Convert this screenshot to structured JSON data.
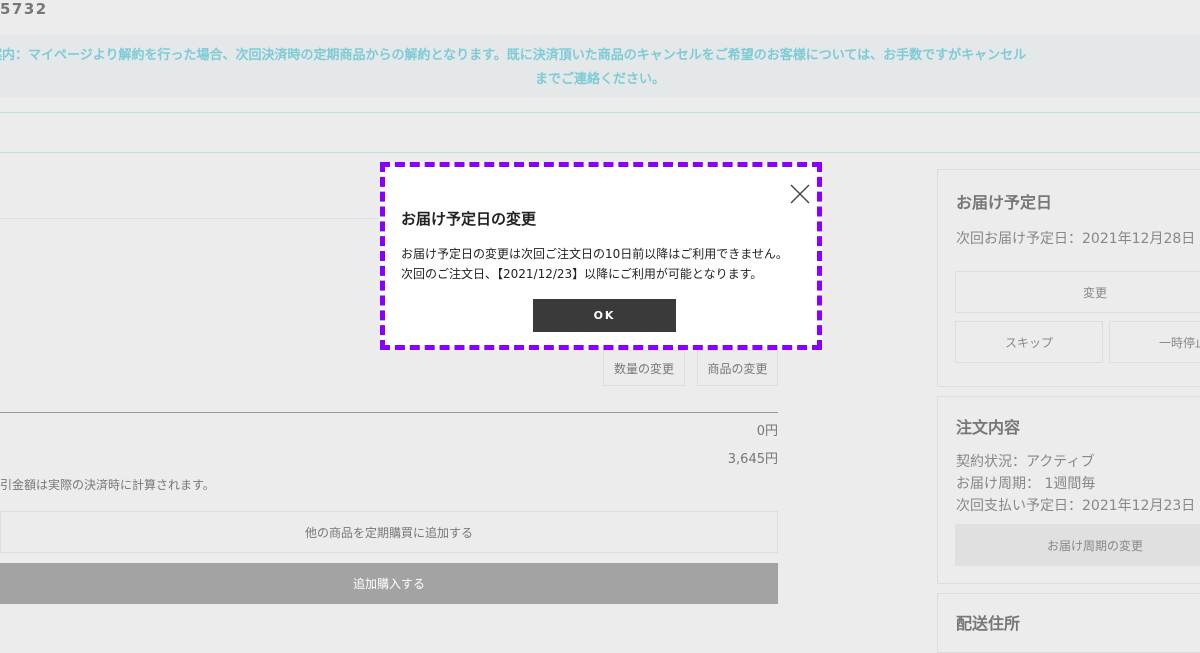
{
  "header": {
    "order_id": "5732",
    "notice_line1": "ご案内：マイページより解約を行った場合、次回決済時の定期商品からの解約となります。既に決済頂いた商品のキャンセルをご希望のお客様については、お手数ですがキャンセル",
    "notice_line2": "までご連絡ください。"
  },
  "main": {
    "qty_change_label": "数量の変更",
    "product_change_label": "商品の変更",
    "price_1": "0円",
    "price_2": "3,645円",
    "discount_note": "引金額は実際の決済時に計算されます。",
    "add_product_label": "他の商品を定期購買に追加する",
    "add_purchase_label": "追加購入する"
  },
  "delivery_panel": {
    "title": "お届け予定日",
    "next_delivery": "次回お届け予定日：2021年12月28日",
    "change_label": "変更",
    "skip_label": "スキップ",
    "pause_label": "一時停止"
  },
  "order_panel": {
    "title": "注文内容",
    "status": "契約状況：アクティブ",
    "cycle": "お届け周期： 1週間毎",
    "next_payment": "次回支払い予定日：2021年12月23日",
    "cycle_change_label": "お届け周期の変更"
  },
  "address_panel": {
    "title": "配送住所"
  },
  "modal": {
    "title": "お届け予定日の変更",
    "body_line1": "お届け予定日の変更は次回ご注文日の10日前以降はご利用できません。",
    "body_line2": "次回のご注文日、【2021/12/23】以降にご利用が可能となります。",
    "ok_label": "OK",
    "close_icon": "close-icon",
    "outline_color": "#8a00ff"
  }
}
